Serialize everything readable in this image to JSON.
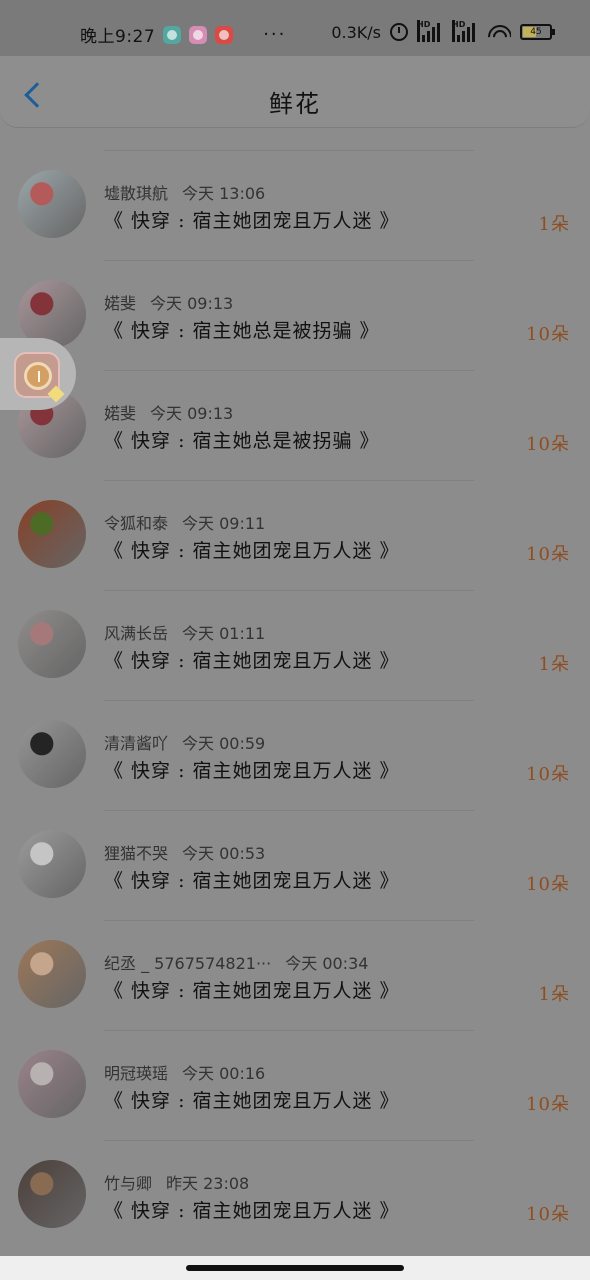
{
  "status_bar": {
    "time": "晚上9:27",
    "more_dots": "···",
    "network_speed": "0.3K/s",
    "battery_level": "45"
  },
  "header": {
    "title": "鲜花"
  },
  "gifts": [
    {
      "name": "墟散琪航",
      "time": "今天 13:06",
      "book": "《 快穿 : 宿主她团宠且万人迷 》",
      "count": "1朵",
      "avatar_color": "#b7c4c8",
      "avatar_accent": "#d36c6c"
    },
    {
      "name": "婼斐",
      "time": "今天 09:13",
      "book": "《 快穿 : 宿主她总是被拐骗 》",
      "count": "10朵",
      "avatar_color": "#c7b0b6",
      "avatar_accent": "#9b3e45"
    },
    {
      "name": "婼斐",
      "time": "今天 09:13",
      "book": "《 快穿 : 宿主她总是被拐骗 》",
      "count": "10朵",
      "avatar_color": "#c7b0b6",
      "avatar_accent": "#9b3e45"
    },
    {
      "name": "令狐和泰",
      "time": "今天 09:11",
      "book": "《 快穿 : 宿主她团宠且万人迷 》",
      "count": "10朵",
      "avatar_color": "#9f4d2e",
      "avatar_accent": "#5b7d2d"
    },
    {
      "name": "风满长岳",
      "time": "今天 01:11",
      "book": "《 快穿 : 宿主她团宠且万人迷 》",
      "count": "1朵",
      "avatar_color": "#a8a6a4",
      "avatar_accent": "#c28f8f"
    },
    {
      "name": "清清酱吖",
      "time": "今天 00:59",
      "book": "《 快穿 : 宿主她团宠且万人迷 》",
      "count": "10朵",
      "avatar_color": "#b1b1b1",
      "avatar_accent": "#2b2b2b"
    },
    {
      "name": "狸猫不哭",
      "time": "今天 00:53",
      "book": "《 快穿 : 宿主她团宠且万人迷 》",
      "count": "10朵",
      "avatar_color": "#b7b7b7",
      "avatar_accent": "#e8e8e8"
    },
    {
      "name": "纪丞 _ 5767574821···",
      "time": "今天 00:34",
      "book": "《 快穿 : 宿主她团宠且万人迷 》",
      "count": "1朵",
      "avatar_color": "#b88d69",
      "avatar_accent": "#e8c4a5"
    },
    {
      "name": "明冠瑛瑶",
      "time": "今天 00:16",
      "book": "《 快穿 : 宿主她团宠且万人迷 》",
      "count": "10朵",
      "avatar_color": "#b59aa4",
      "avatar_accent": "#d9d0d0"
    },
    {
      "name": "竹与卿",
      "time": "昨天 23:08",
      "book": "《 快穿 : 宿主她团宠且万人迷 》",
      "count": "10朵",
      "avatar_color": "#5a4b45",
      "avatar_accent": "#a27e63"
    }
  ],
  "colors": {
    "overlay_background": "#8c8c8c",
    "accent_count": "#8f4d20",
    "back_arrow": "#1d5e96"
  }
}
